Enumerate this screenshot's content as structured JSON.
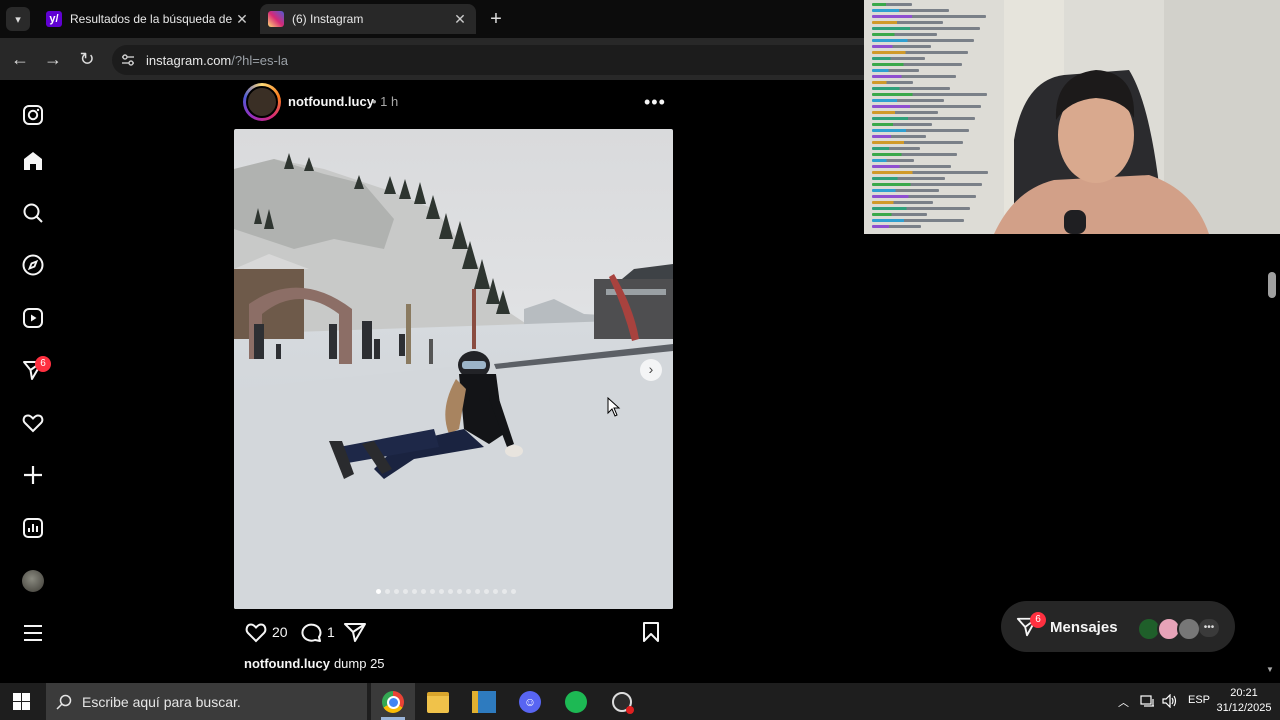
{
  "browser": {
    "tabs": [
      {
        "title": "Resultados de la búsqueda de i",
        "active": false,
        "favicon_color": "#6001d2"
      },
      {
        "title": "(6) Instagram",
        "active": true,
        "favicon_color": "#d62976"
      }
    ],
    "url_domain": "instagram.com",
    "url_path": "/?hl=es-la"
  },
  "sidebar": {
    "items": [
      "instagram-logo-icon",
      "home-icon",
      "search-icon",
      "explore-icon",
      "reels-icon",
      "messages-icon",
      "notifications-icon",
      "create-icon",
      "dashboard-icon",
      "profile-avatar",
      "more-menu-icon"
    ],
    "messages_badge": "6"
  },
  "post": {
    "username": "notfound.lucy",
    "time": "• 1 h",
    "likes": "20",
    "comments": "1",
    "caption_user": "notfound.lucy",
    "caption_text": "dump 25",
    "carousel_count": 16,
    "carousel_index": 1
  },
  "messages_pill": {
    "label": "Mensajes",
    "badge": "6"
  },
  "taskbar": {
    "search_placeholder": "Escribe aquí para buscar.",
    "apps": [
      "chrome-icon",
      "file-explorer-icon",
      "app-icon",
      "discord-icon",
      "spotify-icon",
      "obs-icon"
    ],
    "language": "ESP",
    "time": "20:21",
    "date": "31/12/2025"
  },
  "colors": {
    "accent_red": "#ff3040",
    "background": "#000000"
  }
}
